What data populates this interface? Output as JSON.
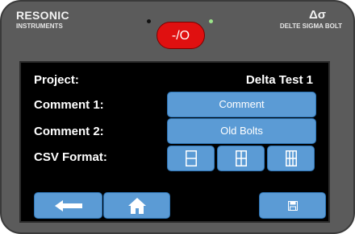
{
  "header": {
    "brand_name": "RESONIC",
    "brand_sub": "INSTRUMENTS",
    "power_label": "-/O",
    "model_symbol": "Δσ",
    "model_name": "DELTE SIGMA BOLT"
  },
  "project": {
    "label": "Project:",
    "value": "Delta Test 1"
  },
  "comment1": {
    "label": "Comment 1:",
    "button_label": "Comment"
  },
  "comment2": {
    "label": "Comment 2:",
    "button_label": "Old Bolts"
  },
  "csv_format": {
    "label": "CSV Format:",
    "options": [
      {
        "icon": "single-column-layout-icon"
      },
      {
        "icon": "two-column-layout-icon"
      },
      {
        "icon": "three-column-layout-icon"
      }
    ]
  },
  "nav": {
    "back_icon": "arrow-left-icon",
    "home_icon": "home-icon",
    "save_icon": "save-icon"
  },
  "colors": {
    "button_fill": "#5b9bd5",
    "button_border": "#2e75b6",
    "power_red": "#e01010",
    "screen_bg": "#000000",
    "bezel": "#5b5b5b",
    "led_green": "#9be58a"
  }
}
